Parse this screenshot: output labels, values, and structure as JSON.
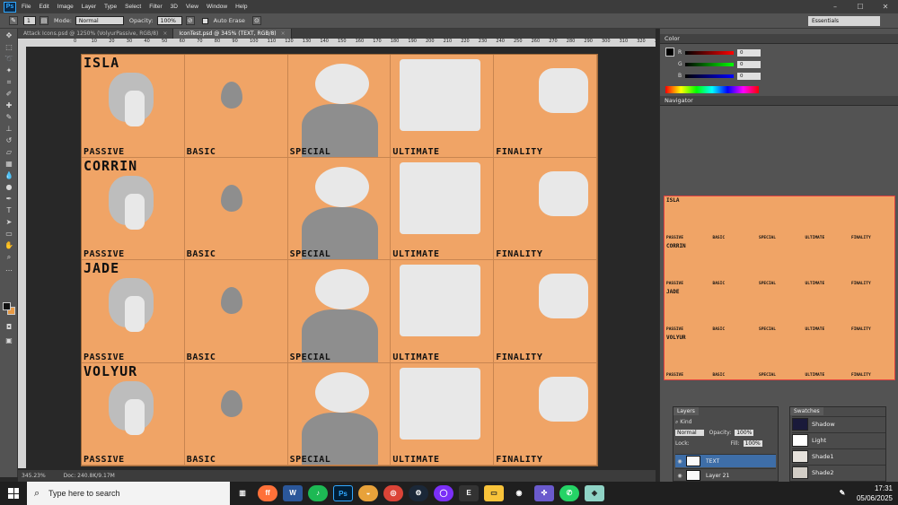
{
  "app": {
    "logo": "Ps",
    "colors": {
      "accent": "#31a8ff",
      "canvas_bg": "#f0a466",
      "panel": "#535353"
    }
  },
  "menu": [
    "File",
    "Edit",
    "Image",
    "Layer",
    "Type",
    "Select",
    "Filter",
    "3D",
    "View",
    "Window",
    "Help"
  ],
  "window_controls": [
    "–",
    "☐",
    "✕"
  ],
  "options": {
    "mode_label": "Mode:",
    "mode_value": "Normal",
    "opacity_label": "Opacity:",
    "opacity_value": "100%",
    "auto_erase": "Auto Erase",
    "size": "1"
  },
  "workspace": "Essentials",
  "tabs": [
    {
      "label": "Attack Icons.psd @ 1250% (VolyurPassive, RGB/8)",
      "close": "×"
    },
    {
      "label": "IconTest.psd @ 345% (TEXT, RGB/8)",
      "close": "×"
    }
  ],
  "ruler_ticks": [
    "0",
    "10",
    "20",
    "30",
    "40",
    "50",
    "60",
    "70",
    "80",
    "90",
    "100",
    "110",
    "120",
    "130",
    "140",
    "150",
    "160",
    "170",
    "180",
    "190",
    "200",
    "210",
    "220",
    "230",
    "240",
    "250",
    "260",
    "270",
    "280",
    "290",
    "300",
    "310",
    "320",
    "330",
    "340"
  ],
  "document": {
    "characters": [
      "ISLA",
      "CORRIN",
      "JADE",
      "VOLYUR"
    ],
    "categories": [
      "PASSIVE",
      "BASIC",
      "SPECIAL",
      "ULTIMATE",
      "FINALITY"
    ]
  },
  "status": {
    "zoom": "345.23%",
    "doc": "Doc: 240.8K/9.17M"
  },
  "panels": {
    "color": {
      "title": "Color",
      "channels": [
        {
          "name": "R",
          "value": "0"
        },
        {
          "name": "G",
          "value": "0"
        },
        {
          "name": "B",
          "value": "0"
        }
      ]
    },
    "navigator": {
      "title": "Navigator"
    },
    "layers": {
      "title": "Layers",
      "kind": "Kind",
      "blend": "Normal",
      "opacity_label": "Opacity:",
      "opacity": "100%",
      "lock_label": "Lock:",
      "fill_label": "Fill:",
      "fill": "100%",
      "items": [
        {
          "name": "TEXT",
          "selected": true
        },
        {
          "name": "Layer 21",
          "selected": false
        }
      ]
    },
    "swatches": {
      "title": "Swatches",
      "items": [
        {
          "name": "Shadow",
          "color": "#1a1a3a"
        },
        {
          "name": "Light",
          "color": "#ffffff"
        },
        {
          "name": "Shade1",
          "color": "#e6e2dc"
        },
        {
          "name": "Shade2",
          "color": "#d2cdc6"
        }
      ]
    }
  },
  "taskbar": {
    "search_placeholder": "Type here to search",
    "time": "17:31",
    "date": "05/06/2025",
    "apps": [
      "task-view",
      "firefox",
      "word",
      "spotify",
      "photoshop",
      "app-orange",
      "chrome",
      "steam",
      "app-purple",
      "epic-games",
      "file-explorer",
      "app-camera",
      "gamepad",
      "whatsapp",
      "app-cube"
    ]
  }
}
